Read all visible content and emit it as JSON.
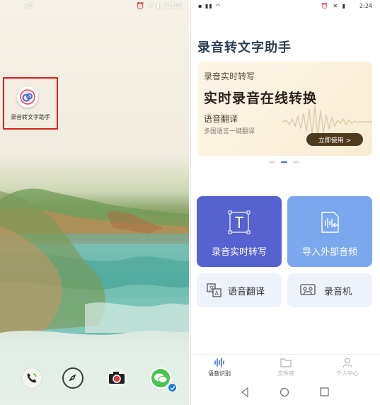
{
  "home_screen": {
    "status_bar": {
      "signal": "4G",
      "time": "11:19"
    },
    "app_shortcut": {
      "label": "录音转文字助手"
    },
    "dock": [
      "phone",
      "browser",
      "camera",
      "wechat"
    ]
  },
  "app": {
    "status_bar": {
      "time": "2:24"
    },
    "title": "录音转文字助手",
    "banner": {
      "kicker": "录音实时转写",
      "headline": "实时录音在线转换",
      "subtitle": "语音翻译",
      "caption": "多国语言一键翻译",
      "cta": "立即使用 >"
    },
    "carousel": {
      "count": 3,
      "active_index": 1
    },
    "features": {
      "realtime": "录音实时转写",
      "import": "导入外部音频",
      "translate": "语音翻译",
      "recorder": "录音机"
    },
    "tabs": [
      {
        "label": "语音识别",
        "active": true
      },
      {
        "label": "文件库",
        "active": false
      },
      {
        "label": "个人中心",
        "active": false
      }
    ],
    "accent_color": "#5662cf"
  }
}
